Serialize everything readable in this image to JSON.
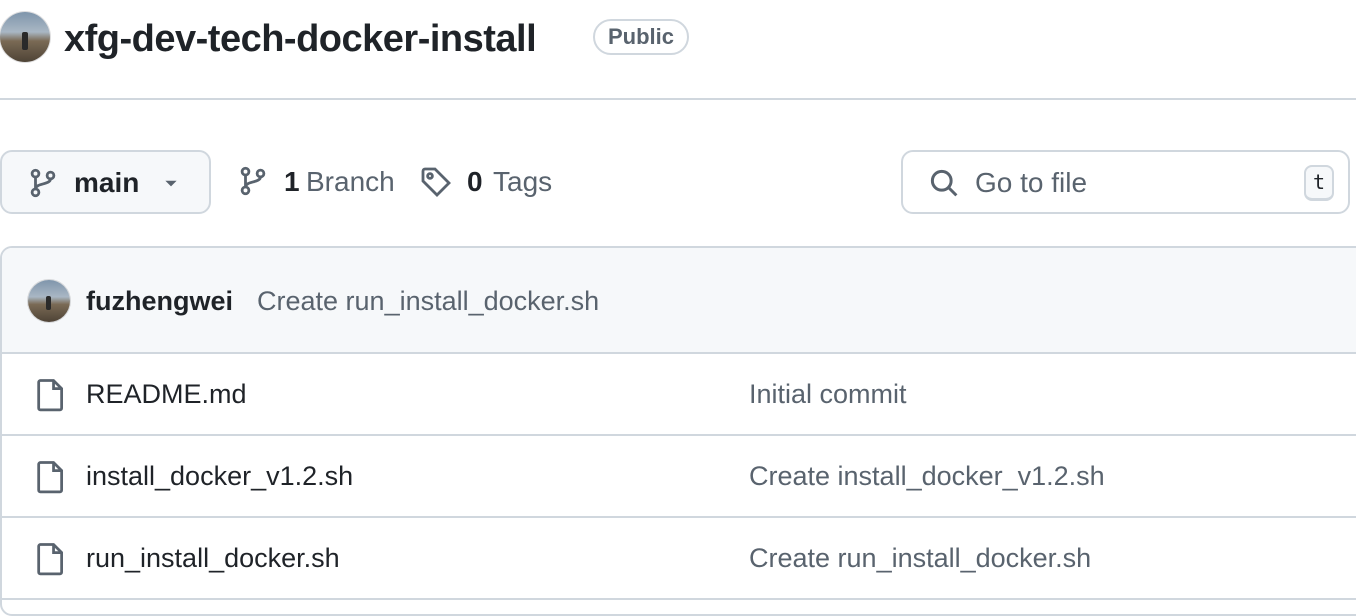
{
  "repo": {
    "name": "xfg-dev-tech-docker-install",
    "visibility": "Public"
  },
  "toolbar": {
    "branch": "main",
    "branch_count": "1",
    "branch_label": "Branch",
    "tag_count": "0",
    "tag_label": "Tags",
    "search_placeholder": "Go to file",
    "search_shortcut": "t"
  },
  "latest_commit": {
    "author": "fuzhengwei",
    "message": "Create run_install_docker.sh"
  },
  "files": [
    {
      "name": "README.md",
      "commit": "Initial commit",
      "icon": "file-icon"
    },
    {
      "name": "install_docker_v1.2.sh",
      "commit": "Create install_docker_v1.2.sh",
      "icon": "file-icon"
    },
    {
      "name": "run_install_docker.sh",
      "commit": "Create run_install_docker.sh",
      "icon": "file-icon"
    }
  ],
  "colors": {
    "text": "#1f2328",
    "muted": "#59636e",
    "border": "#d0d7de",
    "subtle_bg": "#f6f8fa"
  }
}
